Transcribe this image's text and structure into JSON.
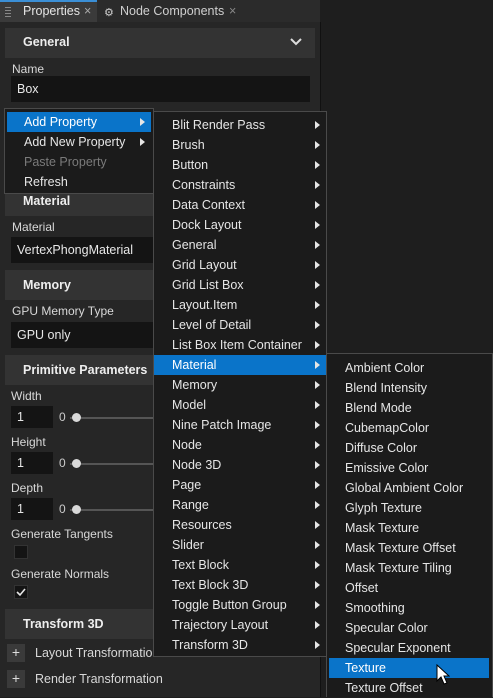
{
  "tabs": [
    {
      "label": "Properties",
      "close": "×"
    },
    {
      "label": "Node Components",
      "close": "×"
    }
  ],
  "sections": {
    "general": "General",
    "material": "Material",
    "memory": "Memory",
    "primitive": "Primitive Parameters",
    "transform3d": "Transform 3D"
  },
  "fields": {
    "name_label": "Name",
    "name_value": "Box",
    "material_label": "Material",
    "material_value": "VertexPhongMaterial",
    "gpu_label": "GPU Memory Type",
    "gpu_value": "GPU only",
    "width_label": "Width",
    "width_value": "1",
    "width_min": "0",
    "height_label": "Height",
    "height_value": "1",
    "height_min": "0",
    "depth_label": "Depth",
    "depth_value": "1",
    "depth_min": "0",
    "gen_tangents_label": "Generate Tangents",
    "gen_normals_label": "Generate Normals",
    "gen_tangents_checked": false,
    "gen_normals_checked": true
  },
  "collapsed": [
    {
      "label": "Layout Transformation",
      "icon": "+"
    },
    {
      "label": "Render Transformation",
      "icon": "+"
    }
  ],
  "context_menu": [
    {
      "label": "Add Property",
      "highlighted": true,
      "submenu": true,
      "disabled": false
    },
    {
      "label": "Add New Property",
      "highlighted": false,
      "submenu": true,
      "disabled": false
    },
    {
      "label": "Paste Property",
      "highlighted": false,
      "submenu": false,
      "disabled": true
    },
    {
      "label": "Refresh",
      "highlighted": false,
      "submenu": false,
      "disabled": false
    }
  ],
  "property_categories": [
    "Blit Render Pass",
    "Brush",
    "Button",
    "Constraints",
    "Data Context",
    "Dock Layout",
    "General",
    "Grid Layout",
    "Grid List Box",
    "Layout.Item",
    "Level of Detail",
    "List Box Item Container",
    "Material",
    "Memory",
    "Model",
    "Nine Patch Image",
    "Node",
    "Node 3D",
    "Page",
    "Range",
    "Resources",
    "Slider",
    "Text Block",
    "Text Block 3D",
    "Toggle Button Group",
    "Trajectory Layout",
    "Transform 3D"
  ],
  "property_categories_highlighted": "Material",
  "material_properties": [
    "Ambient Color",
    "Blend Intensity",
    "Blend Mode",
    "CubemapColor",
    "Diffuse Color",
    "Emissive Color",
    "Global Ambient Color",
    "Glyph Texture",
    "Mask Texture",
    "Mask Texture Offset",
    "Mask Texture Tiling",
    "Offset",
    "Smoothing",
    "Specular Color",
    "Specular Exponent",
    "Texture",
    "Texture Offset"
  ],
  "material_properties_highlighted": "Texture",
  "colors": {
    "highlight": "#0a74c9",
    "tab_accent": "#3b8fd6"
  }
}
